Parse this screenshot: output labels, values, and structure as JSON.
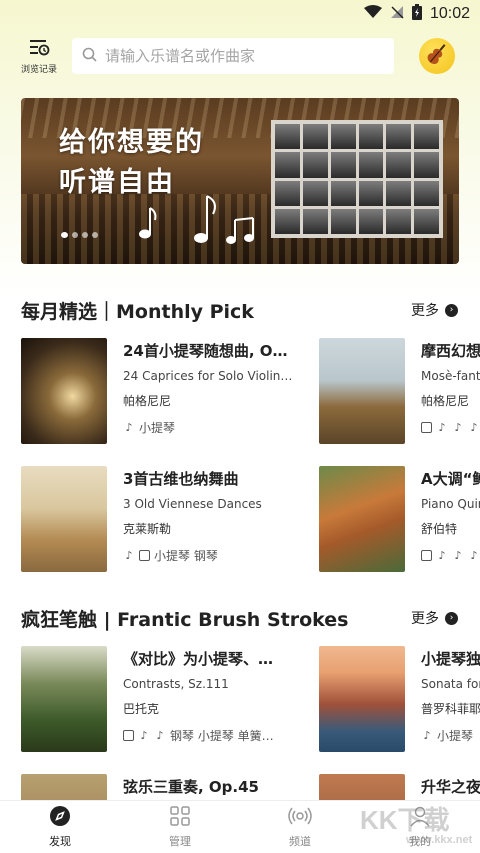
{
  "status_bar": {
    "time": "10:02"
  },
  "header": {
    "history_label": "浏览记录",
    "search_placeholder": "请输入乐谱名或作曲家"
  },
  "banner": {
    "line1": "给你想要的",
    "line2": "听谱自由",
    "slide_count": 4,
    "active_slide": 0
  },
  "monthly": {
    "title": "每月精选｜Monthly Pick",
    "more": "更多",
    "cards": [
      {
        "title": "24首小提琴随想曲, O…",
        "subtitle": "24 Caprices for Solo Violin…",
        "composer": "帕格尼尼",
        "tags": "小提琴",
        "icons": [
          "violin-icon"
        ]
      },
      {
        "title": "摩西幻想",
        "subtitle": "Mosè-fanta",
        "composer": "帕格尼尼",
        "tags": "",
        "icons": [
          "piano-icon",
          "violin-icon",
          "guitar-icon",
          "violin-icon"
        ]
      },
      {
        "title": "3首古维也纳舞曲",
        "subtitle": "3 Old Viennese Dances",
        "composer": "克莱斯勒",
        "tags": "小提琴 钢琴",
        "icons": [
          "violin-icon",
          "piano-icon"
        ]
      },
      {
        "title": "A大调“鳟",
        "subtitle": "Piano Quin",
        "composer": "舒伯特",
        "tags": "",
        "icons": [
          "piano-icon",
          "violin-icon",
          "violin-icon",
          "violin-icon"
        ]
      }
    ]
  },
  "brush": {
    "title": "疯狂笔触 | Frantic Brush Strokes",
    "more": "更多",
    "cards": [
      {
        "title": "《对比》为小提琴、…",
        "subtitle": "Contrasts, Sz.111",
        "composer": "巴托克",
        "tags": "钢琴 小提琴 单簧…",
        "icons": [
          "piano-icon",
          "violin-icon",
          "clarinet-icon"
        ]
      },
      {
        "title": "小提琴独",
        "subtitle": "Sonata for",
        "composer": "普罗科菲耶",
        "tags": "小提琴",
        "icons": [
          "violin-icon"
        ]
      },
      {
        "title": "弦乐三重奏, Op.45",
        "subtitle": "",
        "composer": "",
        "tags": "",
        "icons": []
      },
      {
        "title": "升华之夜",
        "subtitle": "",
        "composer": "",
        "tags": "",
        "icons": []
      }
    ]
  },
  "bottom_nav": {
    "items": [
      {
        "label": "发现",
        "icon": "compass-icon",
        "active": true
      },
      {
        "label": "管理",
        "icon": "grid-icon",
        "active": false
      },
      {
        "label": "频道",
        "icon": "radio-icon",
        "active": false
      },
      {
        "label": "我的",
        "icon": "user-icon",
        "active": false
      }
    ]
  },
  "watermark": {
    "text": "KK下载",
    "url": "www.kkx.net"
  },
  "colors": {
    "accent_yellow": "#f3c21a",
    "header_bg": "#f6f7cf",
    "text_dark": "#222222"
  }
}
